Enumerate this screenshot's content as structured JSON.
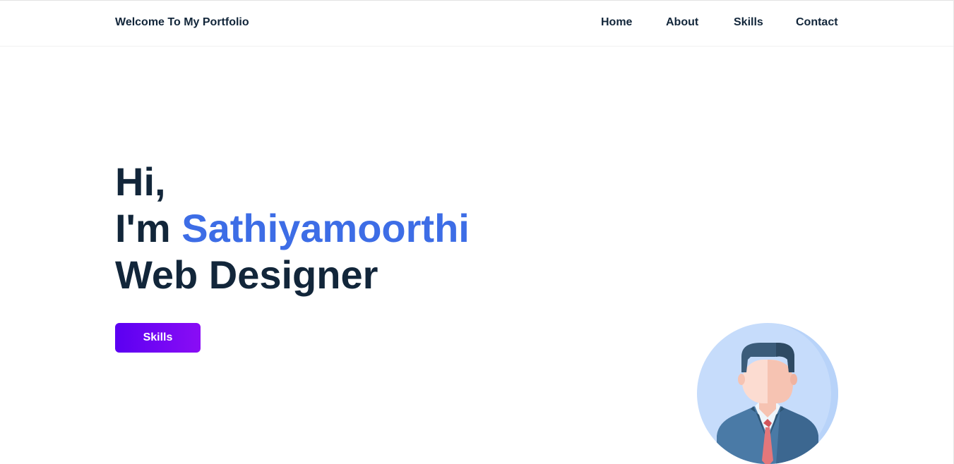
{
  "header": {
    "brand": "Welcome To My Portfolio",
    "nav": [
      "Home",
      "About",
      "Skills",
      "Contact"
    ]
  },
  "hero": {
    "line1": "Hi,",
    "line2_prefix": "I'm ",
    "name": "Sathiyamoorthi",
    "line3": "Web Designer",
    "cta_label": "Skills"
  },
  "colors": {
    "text": "#12263a",
    "accent": "#3d6de6",
    "button_start": "#5b00f2",
    "button_end": "#8a0df5",
    "avatar_bg": "#c6dcfb"
  },
  "icons": {
    "avatar": "businessman-avatar-icon"
  }
}
